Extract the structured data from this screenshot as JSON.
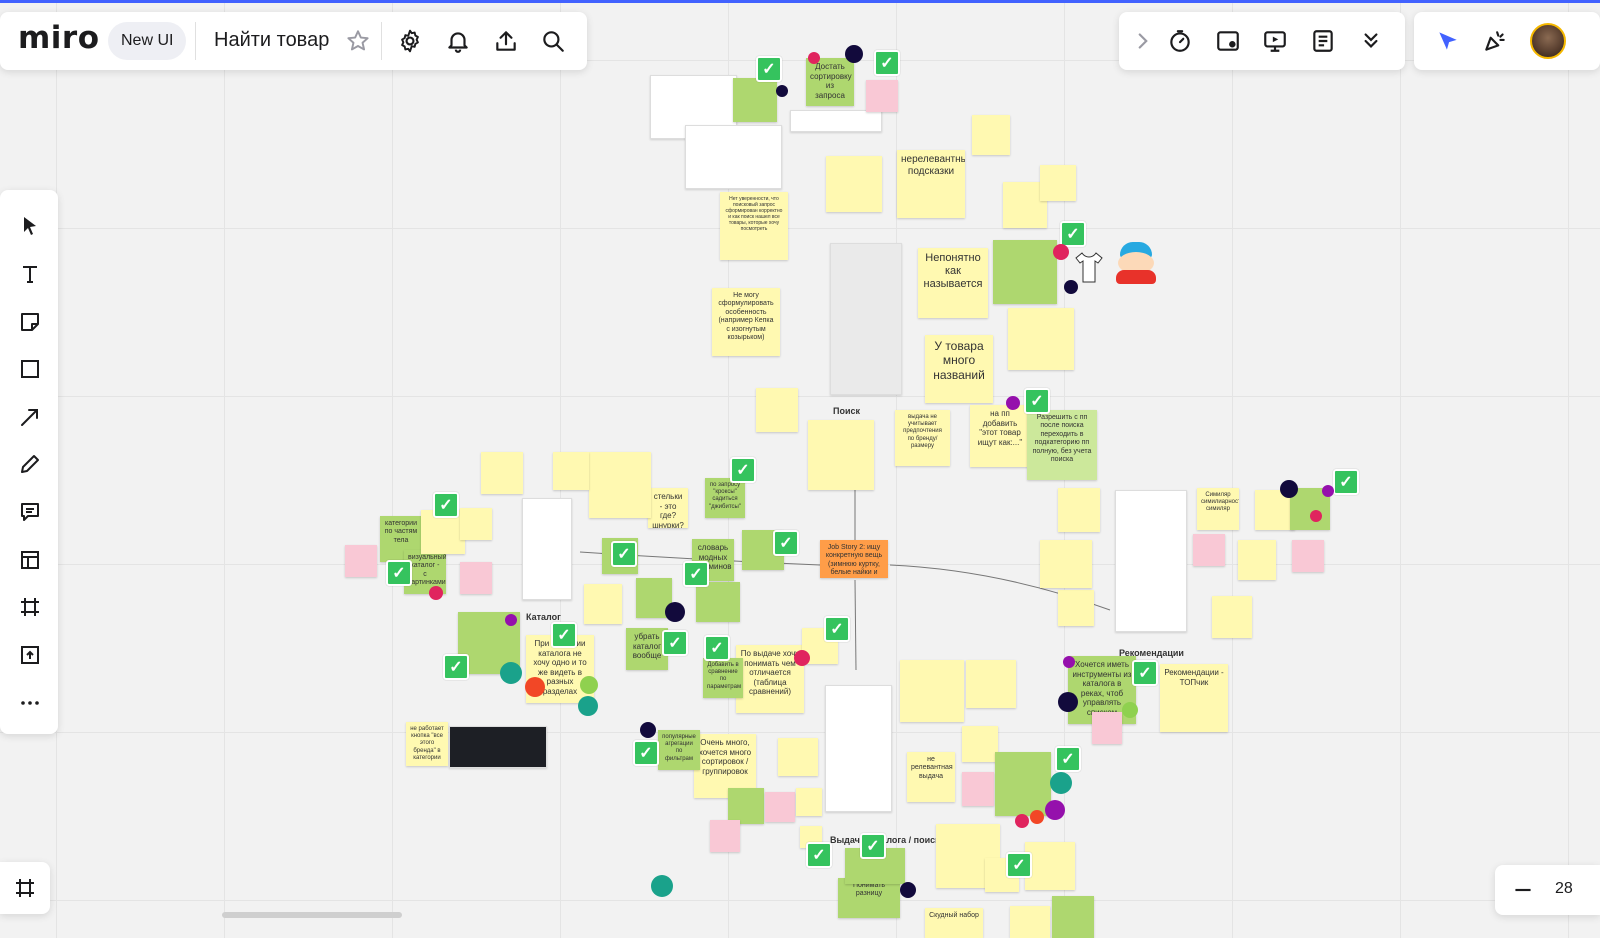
{
  "app": {
    "logo": "miro",
    "badge": "New UI",
    "board_title": "Найти товар"
  },
  "toolbar_icons": [
    "star-icon",
    "settings-icon",
    "bell-icon",
    "upload-icon",
    "search-icon"
  ],
  "right_toolbar_icons": [
    "chevron-right-icon",
    "timer-icon",
    "card-icon",
    "present-icon",
    "notes-icon",
    "chevron-double-down-icon"
  ],
  "collab_icons": [
    "cursor-flag-icon",
    "celebrate-icon",
    "user-avatar"
  ],
  "left_tools": [
    "select-icon",
    "text-icon",
    "sticky-note-icon",
    "shape-icon",
    "arrow-icon",
    "pen-icon",
    "comment-icon",
    "template-icon",
    "frame-icon",
    "upload-icon",
    "more-icon"
  ],
  "frames_button_icon": "frames-icon",
  "zoom": {
    "value": "28"
  },
  "colors": {
    "accent": "#4262ff",
    "yellow": "#fff9b1",
    "green": "#aed76f",
    "orange": "#ff9d48",
    "pink": "#f9c8d5"
  },
  "sections": {
    "search": "Поиск",
    "catalog": "Каталог",
    "recommendations": "Рекомендации",
    "results": "Выдача каталога / поиска"
  },
  "stickies": {
    "s1": "Достать сортировку из запроса",
    "s2": "нерелевантные подсказки",
    "s3": "Непонятно как называется",
    "s4": "У товара много названий",
    "s5": "Не могу сформулировать особенность (например Кепка с изогнутым козырьком)",
    "s6": "на пп добавить \"этот товар ищут как:...\"",
    "s7": "Разрешить с пп после поиска переходить в подкатегорию пп полную, без учета поиска",
    "s8": "Job Story 2: ищу конкретную вещь (зимнюю куртку, белые найки и т.п.)",
    "s9": "категории по частям тела",
    "s10": "визуальный каталог - с картинками",
    "s11": "стельки - это где? шнурки?",
    "s12": "словарь модных терминов",
    "s13": "При изучении каталога не хочу одно и то же видеть в разных разделах",
    "s14": "убрать каталог вообще",
    "s15": "По выдаче хочу понимать чем отличается (таблица сравнений)",
    "s16": "Очень много, хочется много сортировок / группировок",
    "s17": "Хочется иметь инструменты из каталога в реках, чтоб управлять списком",
    "s18": "Рекомендации - ТОПчик",
    "s19": "не релевантная выдача",
    "s20": "Понимать разницу",
    "s21": "не работает кнопка \"все этого бренда\" в категории",
    "s22": "популярные агрегации по фильтрам",
    "s23": "Симиляр симилиарность симиляр",
    "s24": "Нет уверенности, что поисковый запрос сформирован корректно и как поиск нашел все товары, которые хочу посмотреть",
    "s25": "выдача не учитывает предпочтения по бренду/размеру",
    "s26": "по запросу \"кроксы\" садиться \"джибитсы\"",
    "s27": "Добавить в сравнение по параметрам",
    "s28": "Скудный набор"
  }
}
